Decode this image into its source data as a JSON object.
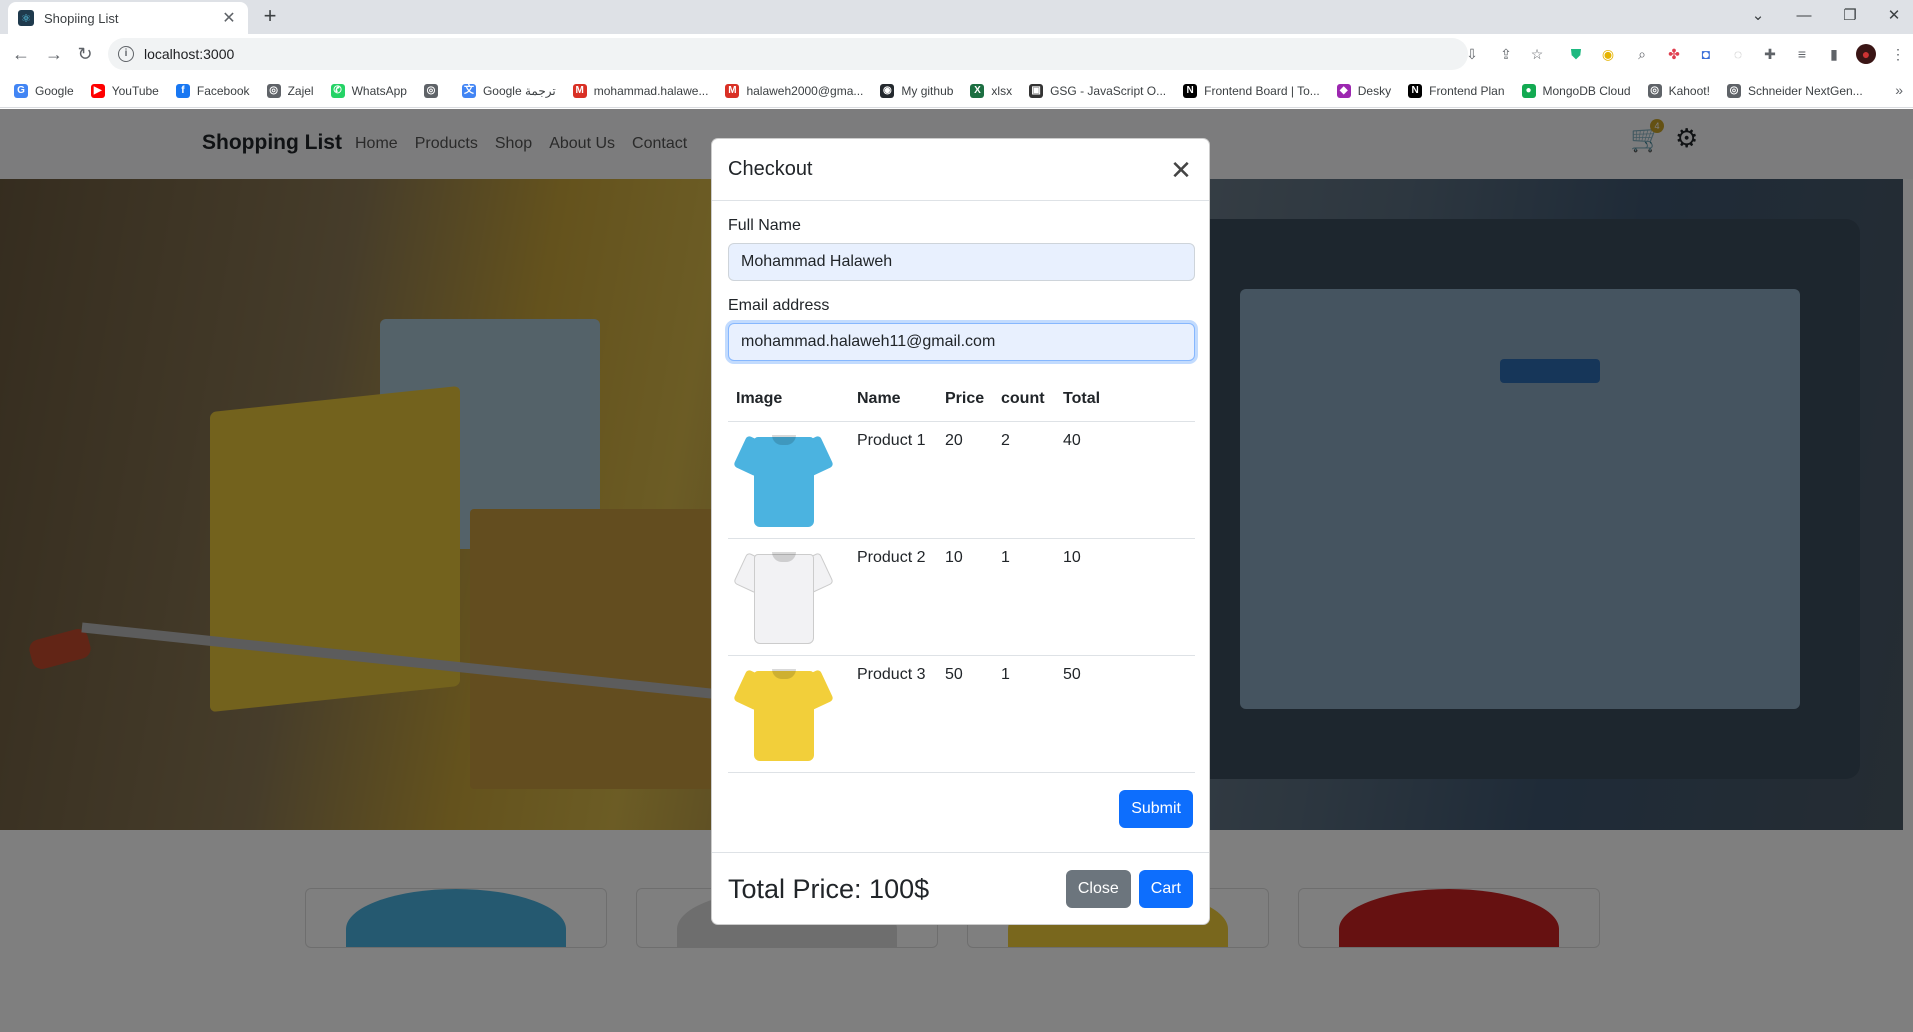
{
  "browser": {
    "tab_title": "Shopiing List",
    "url": "localhost:3000",
    "bookmarks": [
      {
        "label": "Google",
        "color": "#4285f4",
        "glyph": "G"
      },
      {
        "label": "YouTube",
        "color": "#ff0000",
        "glyph": "▶"
      },
      {
        "label": "Facebook",
        "color": "#1877f2",
        "glyph": "f"
      },
      {
        "label": "Zajel",
        "color": "#5f6368",
        "glyph": "◎"
      },
      {
        "label": "WhatsApp",
        "color": "#25d366",
        "glyph": "✆"
      },
      {
        "label": "",
        "color": "#5f6368",
        "glyph": "◎"
      },
      {
        "label": "Google ترجمة",
        "color": "#4285f4",
        "glyph": "文"
      },
      {
        "label": "mohammad.halawe...",
        "color": "#d93025",
        "glyph": "M"
      },
      {
        "label": "halaweh2000@gma...",
        "color": "#d93025",
        "glyph": "M"
      },
      {
        "label": "My github",
        "color": "#24292e",
        "glyph": "◉"
      },
      {
        "label": "xlsx",
        "color": "#1d6f42",
        "glyph": "X"
      },
      {
        "label": "GSG - JavaScript O...",
        "color": "#333333",
        "glyph": "▣"
      },
      {
        "label": "Frontend Board | To...",
        "color": "#000000",
        "glyph": "N"
      },
      {
        "label": "Desky",
        "color": "#9c27b0",
        "glyph": "◆"
      },
      {
        "label": "Frontend Plan",
        "color": "#000000",
        "glyph": "N"
      },
      {
        "label": "MongoDB Cloud",
        "color": "#13aa52",
        "glyph": "●"
      },
      {
        "label": "Kahoot!",
        "color": "#5f6368",
        "glyph": "◎"
      },
      {
        "label": "Schneider NextGen...",
        "color": "#5f6368",
        "glyph": "◎"
      }
    ]
  },
  "site": {
    "brand": "Shopping List",
    "nav": [
      "Home",
      "Products",
      "Shop",
      "About Us",
      "Contact"
    ],
    "cart_count": "4"
  },
  "modal": {
    "title": "Checkout",
    "full_name_label": "Full Name",
    "full_name_value": "Mohammad Halaweh",
    "email_label": "Email address",
    "email_value": "mohammad.halaweh11@gmail.com",
    "table_headers": [
      "Image",
      "Name",
      "Price",
      "count",
      "Total"
    ],
    "items": [
      {
        "name": "Product 1",
        "price": "20",
        "count": "2",
        "total": "40",
        "shirt_color": "#4bb3e0"
      },
      {
        "name": "Product 2",
        "price": "10",
        "count": "1",
        "total": "10",
        "shirt_color": "#f2f2f4"
      },
      {
        "name": "Product 3",
        "price": "50",
        "count": "1",
        "total": "50",
        "shirt_color": "#f2cf3a"
      }
    ],
    "submit_label": "Submit",
    "total_price": "Total Price: 100$",
    "close_label": "Close",
    "cart_label": "Cart"
  },
  "colors": {
    "primary": "#0d6efd",
    "secondary": "#6c757d",
    "card_shirts": [
      "#4bb3e0",
      "#dddddd",
      "#f2cf3a",
      "#cc2222"
    ]
  }
}
